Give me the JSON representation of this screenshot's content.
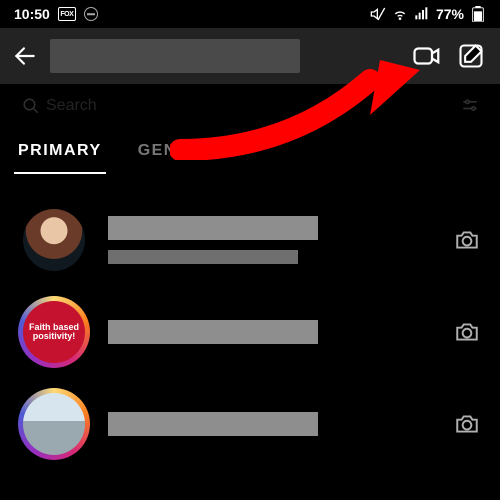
{
  "status": {
    "time": "10:50",
    "badge": "FOX",
    "battery_percent": "77%"
  },
  "topbar": {
    "title_redacted": true
  },
  "search": {
    "placeholder": "Search"
  },
  "tabs": {
    "primary": "PRIMARY",
    "general": "GENERAL",
    "active": "primary"
  },
  "conversations": [
    {
      "avatar_kind": "portrait-woman",
      "name_redacted": true,
      "preview_redacted": true
    },
    {
      "avatar_kind": "story-ring-quote",
      "badge_text": "Faith based positivity!",
      "name_redacted": true
    },
    {
      "avatar_kind": "story-ring-family",
      "name_redacted": true
    }
  ],
  "annotation": {
    "arrow_target": "video-call-icon",
    "color": "#ff0000"
  }
}
